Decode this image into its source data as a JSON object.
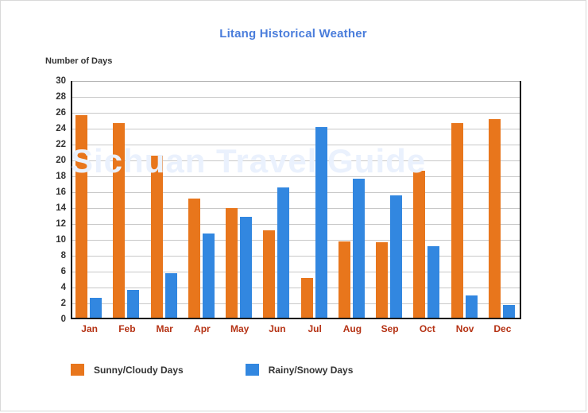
{
  "chart_data": {
    "type": "bar",
    "title": "Litang Historical Weather",
    "xlabel": "",
    "ylabel": "Number of Days",
    "ylim": [
      0,
      30
    ],
    "ytick_step": 2,
    "grid": true,
    "legend_position": "bottom-left",
    "categories": [
      "Jan",
      "Feb",
      "Mar",
      "Apr",
      "May",
      "Jun",
      "Jul",
      "Aug",
      "Sep",
      "Oct",
      "Nov",
      "Dec"
    ],
    "yticks": [
      30,
      28,
      26,
      24,
      22,
      20,
      18,
      16,
      14,
      12,
      10,
      8,
      6,
      4,
      2,
      0
    ],
    "series": [
      {
        "name": "Sunny/Cloudy Days",
        "color": "#e8761c",
        "values": [
          25.5,
          24.5,
          20.4,
          15.0,
          13.8,
          11.0,
          5.0,
          9.6,
          9.5,
          18.5,
          24.5,
          25.0
        ]
      },
      {
        "name": "Rainy/Snowy Days",
        "color": "#3287e0",
        "values": [
          2.5,
          3.5,
          5.6,
          10.6,
          12.7,
          16.4,
          24.0,
          17.5,
          15.4,
          9.0,
          2.8,
          1.6
        ]
      }
    ],
    "watermark": "Sichuan Travel Guide",
    "title_color": "#4a7ddb",
    "xtick_color": "#b53214",
    "ytick_color": "#333333"
  }
}
